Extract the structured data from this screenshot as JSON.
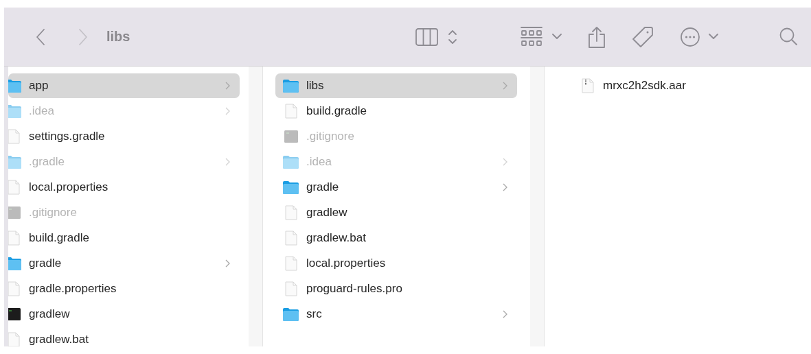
{
  "toolbar": {
    "title": "libs"
  },
  "columns": [
    {
      "items": [
        {
          "name": "app",
          "kind": "folder",
          "hidden": false,
          "selected": true
        },
        {
          "name": ".idea",
          "kind": "folder",
          "hidden": true,
          "selected": false
        },
        {
          "name": "settings.gradle",
          "kind": "file",
          "hidden": false,
          "selected": false
        },
        {
          "name": ".gradle",
          "kind": "folder",
          "hidden": true,
          "selected": false
        },
        {
          "name": "local.properties",
          "kind": "file",
          "hidden": false,
          "selected": false
        },
        {
          "name": ".gitignore",
          "kind": "script",
          "hidden": true,
          "selected": false
        },
        {
          "name": "build.gradle",
          "kind": "file",
          "hidden": false,
          "selected": false
        },
        {
          "name": "gradle",
          "kind": "folder",
          "hidden": false,
          "selected": false
        },
        {
          "name": "gradle.properties",
          "kind": "file",
          "hidden": false,
          "selected": false
        },
        {
          "name": "gradlew",
          "kind": "terminal",
          "hidden": false,
          "selected": false
        },
        {
          "name": "gradlew.bat",
          "kind": "file",
          "hidden": false,
          "selected": false
        }
      ]
    },
    {
      "items": [
        {
          "name": "libs",
          "kind": "folder",
          "hidden": false,
          "selected": true
        },
        {
          "name": "build.gradle",
          "kind": "file",
          "hidden": false,
          "selected": false
        },
        {
          "name": ".gitignore",
          "kind": "script",
          "hidden": true,
          "selected": false
        },
        {
          "name": ".idea",
          "kind": "folder",
          "hidden": true,
          "selected": false
        },
        {
          "name": "gradle",
          "kind": "folder",
          "hidden": false,
          "selected": false
        },
        {
          "name": "gradlew",
          "kind": "file",
          "hidden": false,
          "selected": false
        },
        {
          "name": "gradlew.bat",
          "kind": "file",
          "hidden": false,
          "selected": false
        },
        {
          "name": "local.properties",
          "kind": "file",
          "hidden": false,
          "selected": false
        },
        {
          "name": "proguard-rules.pro",
          "kind": "file",
          "hidden": false,
          "selected": false
        },
        {
          "name": "src",
          "kind": "folder",
          "hidden": false,
          "selected": false
        }
      ]
    },
    {
      "items": [
        {
          "name": "mrxc2h2sdk.aar",
          "kind": "archive",
          "hidden": false,
          "selected": false
        }
      ]
    }
  ]
}
